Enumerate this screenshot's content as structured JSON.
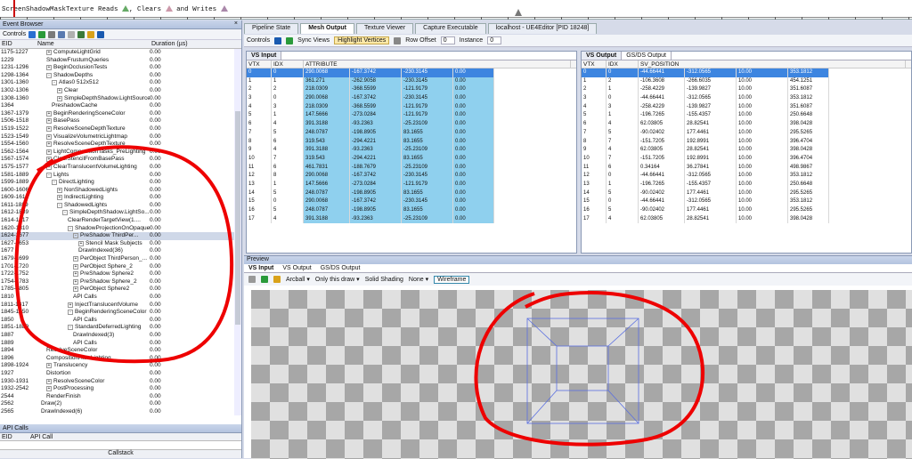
{
  "timeline": {
    "parts": [
      "ScreenShadowMaskTexture Reads",
      ", Clears",
      "and Writes"
    ]
  },
  "event_browser": {
    "title": "Event Browser",
    "close": "×",
    "controls_label": "Controls",
    "columns": {
      "eid": "EID",
      "name": "Name",
      "duration": "Duration (µs)"
    },
    "rows": [
      {
        "eid": "1175-1227",
        "name": "ComputeLightGrid",
        "dur": "0.00",
        "ind": 2,
        "exp": "+"
      },
      {
        "eid": "1229",
        "name": "ShadowFrustumQueries",
        "dur": "0.00",
        "ind": 2,
        "exp": ""
      },
      {
        "eid": "1231-1296",
        "name": "BeginOcclusionTests",
        "dur": "0.00",
        "ind": 2,
        "exp": "+"
      },
      {
        "eid": "1298-1364",
        "name": "ShadowDepths",
        "dur": "0.00",
        "ind": 2,
        "exp": "-"
      },
      {
        "eid": "1301-1360",
        "name": "Atlas0 512x512",
        "dur": "0.00",
        "ind": 3,
        "exp": "-"
      },
      {
        "eid": "1302-1306",
        "name": "Clear",
        "dur": "0.00",
        "ind": 4,
        "exp": "+"
      },
      {
        "eid": "1308-1360",
        "name": "SimpleDepthShadow.LightSource",
        "dur": "0.00",
        "ind": 4,
        "exp": "+"
      },
      {
        "eid": "1364",
        "name": "PreshadowCache",
        "dur": "0.00",
        "ind": 3,
        "exp": ""
      },
      {
        "eid": "1367-1379",
        "name": "BeginRenderingSceneColor",
        "dur": "0.00",
        "ind": 2,
        "exp": "+"
      },
      {
        "eid": "1506-1518",
        "name": "BasePass",
        "dur": "0.00",
        "ind": 2,
        "exp": "+"
      },
      {
        "eid": "1519-1522",
        "name": "ResolveSceneDepthTexture",
        "dur": "0.00",
        "ind": 2,
        "exp": "+"
      },
      {
        "eid": "1523-1549",
        "name": "VisualizeVolumetricLightmap",
        "dur": "0.00",
        "ind": 2,
        "exp": "+"
      },
      {
        "eid": "1554-1560",
        "name": "ResolveSceneDepthTexture",
        "dur": "0.00",
        "ind": 2,
        "exp": "+"
      },
      {
        "eid": "1562-1564",
        "name": "LightCompositionTasks_PreLighting",
        "dur": "0.00",
        "ind": 2,
        "exp": "+"
      },
      {
        "eid": "1567-1574",
        "name": "ClearStencilFromBasePass",
        "dur": "0.00",
        "ind": 2,
        "exp": "+"
      },
      {
        "eid": "1575-1577",
        "name": "ClearTranslucentVolumeLighting",
        "dur": "0.00",
        "ind": 2,
        "exp": "+"
      },
      {
        "eid": "1581-1889",
        "name": "Lights",
        "dur": "0.00",
        "ind": 2,
        "exp": "-"
      },
      {
        "eid": "1599-1889",
        "name": "DirectLighting",
        "dur": "0.00",
        "ind": 3,
        "exp": "-"
      },
      {
        "eid": "1600-1606",
        "name": "NonShadowedLights",
        "dur": "0.00",
        "ind": 4,
        "exp": "+"
      },
      {
        "eid": "1609-1610",
        "name": "IndirectLighting",
        "dur": "0.00",
        "ind": 4,
        "exp": "+"
      },
      {
        "eid": "1611-1889",
        "name": "ShadowedLights",
        "dur": "0.00",
        "ind": 4,
        "exp": "-"
      },
      {
        "eid": "1612-1889",
        "name": "SimpleDepthShadow.LightSo...",
        "dur": "0.00",
        "ind": 5,
        "exp": "-"
      },
      {
        "eid": "1614-1617",
        "name": "ClearRenderTargetView(1....",
        "dur": "0.00",
        "ind": 6,
        "exp": ""
      },
      {
        "eid": "1620-1810",
        "name": "ShadowProjectionOnOpaque",
        "dur": "0.00",
        "ind": 6,
        "exp": "-"
      },
      {
        "eid": "1624-1677",
        "name": "PreShadow ThirdPer...",
        "dur": "0.00",
        "ind": 7,
        "exp": "-",
        "sel": true
      },
      {
        "eid": "1627-1653",
        "name": "Stencil Mask Subjects",
        "dur": "0.00",
        "ind": 8,
        "exp": "+"
      },
      {
        "eid": "1677",
        "name": "DrawIndexed(36)",
        "dur": "0.00",
        "ind": 8,
        "exp": ""
      },
      {
        "eid": "1679-1699",
        "name": "PerObject ThirdPerson_...",
        "dur": "0.00",
        "ind": 7,
        "exp": "+"
      },
      {
        "eid": "1701-1720",
        "name": "PerObject Sphere_2",
        "dur": "0.00",
        "ind": 7,
        "exp": "+"
      },
      {
        "eid": "1722-1752",
        "name": "PreShadow Sphere2",
        "dur": "0.00",
        "ind": 7,
        "exp": "+"
      },
      {
        "eid": "1754-1783",
        "name": "PreShadow Sphere_2",
        "dur": "0.00",
        "ind": 7,
        "exp": "+"
      },
      {
        "eid": "1785-1805",
        "name": "PerObject Sphere2",
        "dur": "0.00",
        "ind": 7,
        "exp": "+"
      },
      {
        "eid": "1810",
        "name": "API Calls",
        "dur": "0.00",
        "ind": 7,
        "exp": ""
      },
      {
        "eid": "1811-1817",
        "name": "InjectTranslucentVolume",
        "dur": "0.00",
        "ind": 6,
        "exp": "+"
      },
      {
        "eid": "1845-1850",
        "name": "BeginRenderingSceneColor",
        "dur": "0.00",
        "ind": 6,
        "exp": "-"
      },
      {
        "eid": "1850",
        "name": "API Calls",
        "dur": "0.00",
        "ind": 7,
        "exp": ""
      },
      {
        "eid": "1851-1889",
        "name": "StandardDeferredLighting",
        "dur": "0.00",
        "ind": 6,
        "exp": "-"
      },
      {
        "eid": "1887",
        "name": "DrawIndexed(3)",
        "dur": "0.00",
        "ind": 7,
        "exp": ""
      },
      {
        "eid": "1889",
        "name": "API Calls",
        "dur": "0.00",
        "ind": 7,
        "exp": ""
      },
      {
        "eid": "1894",
        "name": "ResolveSceneColor",
        "dur": "0.00",
        "ind": 2,
        "exp": ""
      },
      {
        "eid": "1896",
        "name": "CompositionAfterLighting",
        "dur": "0.00",
        "ind": 2,
        "exp": ""
      },
      {
        "eid": "1898-1924",
        "name": "Translucency",
        "dur": "0.00",
        "ind": 2,
        "exp": "+"
      },
      {
        "eid": "1927",
        "name": "Distortion",
        "dur": "0.00",
        "ind": 2,
        "exp": ""
      },
      {
        "eid": "1930-1931",
        "name": "ResolveSceneColor",
        "dur": "0.00",
        "ind": 2,
        "exp": "+"
      },
      {
        "eid": "1932-2542",
        "name": "PostProcessing",
        "dur": "0.00",
        "ind": 2,
        "exp": "+"
      },
      {
        "eid": "2544",
        "name": "RenderFinish",
        "dur": "0.00",
        "ind": 2,
        "exp": ""
      },
      {
        "eid": "2562",
        "name": "Draw(2)",
        "dur": "0.00",
        "ind": 1,
        "exp": ""
      },
      {
        "eid": "2565",
        "name": "DrawIndexed(6)",
        "dur": "0.00",
        "ind": 1,
        "exp": ""
      }
    ]
  },
  "api_calls": {
    "title": "API Calls",
    "col_eid": "EID",
    "col_call": "API Call",
    "callstack": "Callstack"
  },
  "tabs": [
    "Pipeline State",
    "Mesh Output",
    "Texture Viewer",
    "Capture Executable",
    "localhost - UE4Editor [PID 18248]"
  ],
  "active_tab": 1,
  "toolbar": {
    "controls": "Controls",
    "sync_views": "Sync Views",
    "highlight_vertices": "Highlight Vertices",
    "row_offset_label": "Row Offset",
    "row_offset": "0",
    "instance_label": "Instance",
    "instance": "0"
  },
  "vs_input": {
    "tab": "VS Input",
    "cols": [
      "VTX",
      "IDX",
      "ATTRIBUTE"
    ],
    "rows": [
      [
        "0",
        "0",
        "290.0068",
        "-167.3742",
        "-230.3145",
        "0.00"
      ],
      [
        "1",
        "1",
        "361.271",
        "-262.9058",
        "-230.3145",
        "0.00"
      ],
      [
        "2",
        "2",
        "218.0309",
        "-368.5599",
        "-121.9179",
        "0.00"
      ],
      [
        "3",
        "0",
        "290.0068",
        "-167.3742",
        "-230.3145",
        "0.00"
      ],
      [
        "4",
        "3",
        "218.0309",
        "-368.5599",
        "-121.9179",
        "0.00"
      ],
      [
        "5",
        "1",
        "147.5666",
        "-273.0284",
        "-121.9179",
        "0.00"
      ],
      [
        "6",
        "4",
        "391.3188",
        "-93.2363",
        "-25.23109",
        "0.00"
      ],
      [
        "7",
        "5",
        "248.0787",
        "-198.8905",
        "83.1655",
        "0.00"
      ],
      [
        "8",
        "6",
        "319.543",
        "-294.4221",
        "83.1655",
        "0.00"
      ],
      [
        "9",
        "4",
        "391.3188",
        "-93.2363",
        "-25.23109",
        "0.00"
      ],
      [
        "10",
        "7",
        "319.543",
        "-294.4221",
        "83.1655",
        "0.00"
      ],
      [
        "11",
        "6",
        "461.7831",
        "-188.7679",
        "-25.23109",
        "0.00"
      ],
      [
        "12",
        "8",
        "290.0068",
        "-167.3742",
        "-230.3145",
        "0.00"
      ],
      [
        "13",
        "1",
        "147.5666",
        "-273.0284",
        "-121.9179",
        "0.00"
      ],
      [
        "14",
        "5",
        "248.0787",
        "-198.8905",
        "83.1655",
        "0.00"
      ],
      [
        "15",
        "0",
        "290.0068",
        "-167.3742",
        "-230.3145",
        "0.00"
      ],
      [
        "16",
        "5",
        "248.0787",
        "-198.8905",
        "83.1655",
        "0.00"
      ],
      [
        "17",
        "4",
        "391.3188",
        "-93.2363",
        "-25.23109",
        "0.00"
      ]
    ]
  },
  "vs_output": {
    "tabs": [
      "VS Output",
      "GS/DS Output"
    ],
    "cols": [
      "VTX",
      "IDX",
      "SV_POSITION"
    ],
    "rows": [
      [
        "0",
        "0",
        "-44.66441",
        "-312.0565",
        "10.00",
        "353.1812"
      ],
      [
        "1",
        "2",
        "-106.3608",
        "-266.6035",
        "10.00",
        "454.1251"
      ],
      [
        "2",
        "1",
        "-258.4229",
        "-139.9827",
        "10.00",
        "351.6087"
      ],
      [
        "3",
        "0",
        "-44.66441",
        "-312.0565",
        "10.00",
        "353.1812"
      ],
      [
        "4",
        "3",
        "-258.4229",
        "-139.9827",
        "10.00",
        "351.6087"
      ],
      [
        "5",
        "1",
        "-196.7265",
        "-155.4357",
        "10.00",
        "250.6648"
      ],
      [
        "6",
        "4",
        "62.03805",
        "28.82541",
        "10.00",
        "398.0428"
      ],
      [
        "7",
        "5",
        "-90.02402",
        "177.4461",
        "10.00",
        "295.5265"
      ],
      [
        "8",
        "7",
        "-151.7205",
        "192.8991",
        "10.00",
        "396.4704"
      ],
      [
        "9",
        "4",
        "62.03805",
        "28.82541",
        "10.00",
        "398.0428"
      ],
      [
        "10",
        "7",
        "-151.7205",
        "192.8991",
        "10.00",
        "396.4704"
      ],
      [
        "11",
        "6",
        "0.34164",
        "36.27841",
        "10.00",
        "498.9867"
      ],
      [
        "12",
        "0",
        "-44.66441",
        "-312.0565",
        "10.00",
        "353.1812"
      ],
      [
        "13",
        "1",
        "-196.7265",
        "-155.4357",
        "10.00",
        "250.6648"
      ],
      [
        "14",
        "5",
        "-90.02402",
        "177.4461",
        "10.00",
        "295.5265"
      ],
      [
        "15",
        "0",
        "-44.66441",
        "-312.0565",
        "10.00",
        "353.1812"
      ],
      [
        "16",
        "5",
        "-90.02402",
        "177.4461",
        "10.00",
        "295.5265"
      ],
      [
        "17",
        "4",
        "62.03805",
        "28.82541",
        "10.00",
        "398.0428"
      ]
    ]
  },
  "preview": {
    "title": "Preview",
    "tabs": [
      "VS Input",
      "VS Output",
      "GS/DS Output"
    ],
    "camera": "Arcball",
    "draw_range": "Only this draw",
    "shading_label": "Solid Shading",
    "shading_value": "None",
    "wireframe": "Wireframe"
  }
}
